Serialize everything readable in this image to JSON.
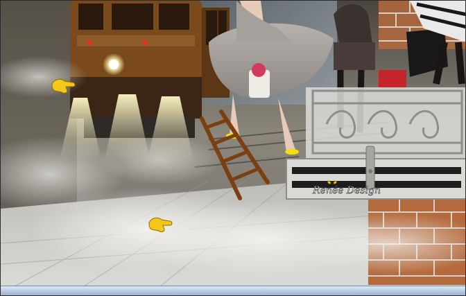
{
  "scene": {
    "watermark": "Renée Design",
    "colors": {
      "fog": "#d7d6d2",
      "tram_body": "#7a4a1c",
      "tram_dark": "#2a1a0e",
      "headlight": "#fff6c8",
      "ladder": "#7b3f12",
      "brick": "#b46a3c",
      "mortar": "#d8d2cc",
      "railing": "#cfcfcf",
      "pointer_hand": "#f2c81b",
      "bar_accent": "#9fb5cf"
    },
    "icons": [
      "pointing-hand-icon",
      "butterfly-icon"
    ]
  }
}
